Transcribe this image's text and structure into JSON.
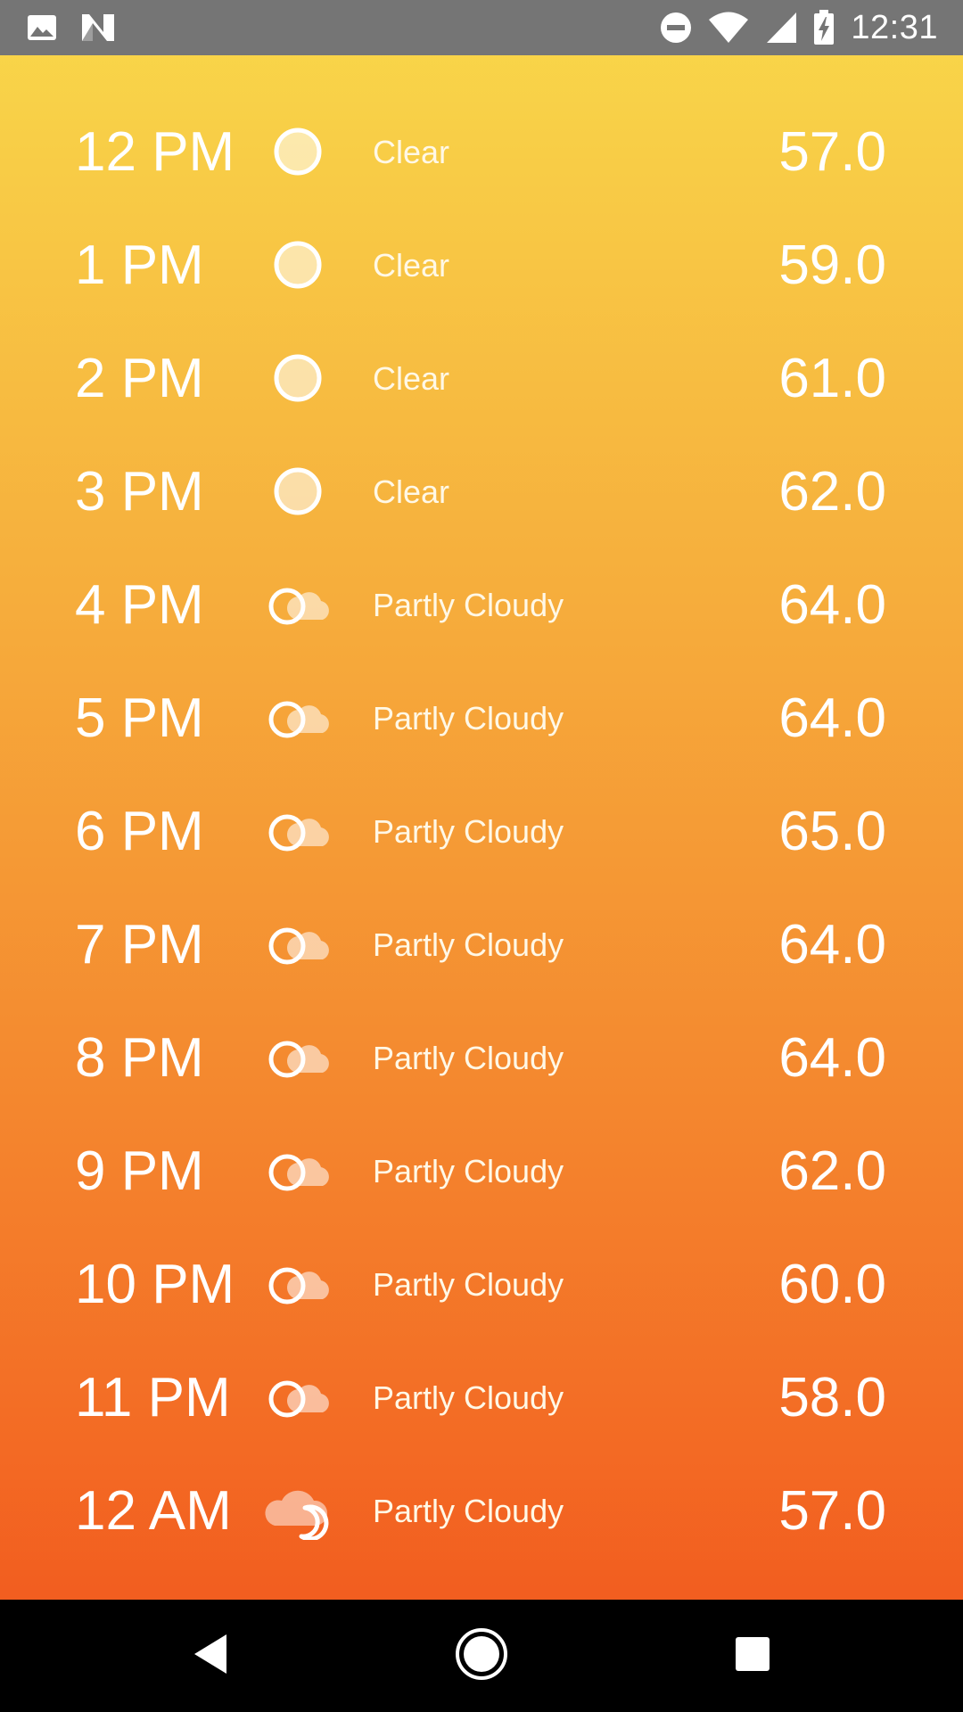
{
  "status_bar": {
    "time": "12:31",
    "left_icons": [
      "image-notification-icon",
      "n-notification-icon"
    ],
    "right_icons": [
      "do-not-disturb-icon",
      "wifi-icon",
      "signal-icon",
      "battery-charging-icon"
    ]
  },
  "forecast": [
    {
      "hour": "12 PM",
      "condition": "Clear",
      "temp": "57.0",
      "icon": "sun-icon"
    },
    {
      "hour": "1 PM",
      "condition": "Clear",
      "temp": "59.0",
      "icon": "sun-icon"
    },
    {
      "hour": "2 PM",
      "condition": "Clear",
      "temp": "61.0",
      "icon": "sun-icon"
    },
    {
      "hour": "3 PM",
      "condition": "Clear",
      "temp": "62.0",
      "icon": "sun-icon"
    },
    {
      "hour": "4 PM",
      "condition": "Partly Cloudy",
      "temp": "64.0",
      "icon": "partly-cloudy-icon"
    },
    {
      "hour": "5 PM",
      "condition": "Partly Cloudy",
      "temp": "64.0",
      "icon": "partly-cloudy-icon"
    },
    {
      "hour": "6 PM",
      "condition": "Partly Cloudy",
      "temp": "65.0",
      "icon": "partly-cloudy-icon"
    },
    {
      "hour": "7 PM",
      "condition": "Partly Cloudy",
      "temp": "64.0",
      "icon": "partly-cloudy-icon"
    },
    {
      "hour": "8 PM",
      "condition": "Partly Cloudy",
      "temp": "64.0",
      "icon": "partly-cloudy-icon"
    },
    {
      "hour": "9 PM",
      "condition": "Partly Cloudy",
      "temp": "62.0",
      "icon": "partly-cloudy-icon"
    },
    {
      "hour": "10 PM",
      "condition": "Partly Cloudy",
      "temp": "60.0",
      "icon": "partly-cloudy-icon"
    },
    {
      "hour": "11 PM",
      "condition": "Partly Cloudy",
      "temp": "58.0",
      "icon": "partly-cloudy-icon"
    },
    {
      "hour": "12 AM",
      "condition": "Partly Cloudy",
      "temp": "57.0",
      "icon": "partly-cloudy-night-icon"
    }
  ],
  "nav_bar": {
    "buttons": [
      "back-icon",
      "home-icon",
      "recents-icon"
    ]
  },
  "colors": {
    "gradient_top": "#f9d84a",
    "gradient_bottom": "#f2541c",
    "status_bar": "#757575",
    "nav_bar": "#000000",
    "text": "#ffffff"
  }
}
